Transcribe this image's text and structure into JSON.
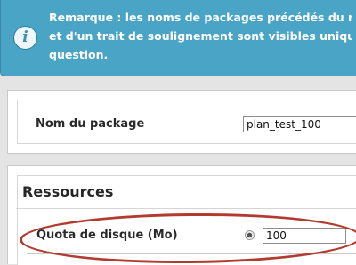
{
  "notice": {
    "icon": "info-icon",
    "lines": [
      "Remarque : les noms de packages précédés du nom d",
      "et d'un trait de soulignement sont visibles uniqueme",
      "question."
    ]
  },
  "package": {
    "label": "Nom du package",
    "value": "plan_test_100"
  },
  "resources": {
    "title": "Ressources",
    "disk_quota": {
      "label": "Quota de disque (Mo)",
      "value": "100"
    }
  },
  "colors": {
    "notice_bg": "#4aa4c6",
    "highlight": "#b23b2f"
  }
}
